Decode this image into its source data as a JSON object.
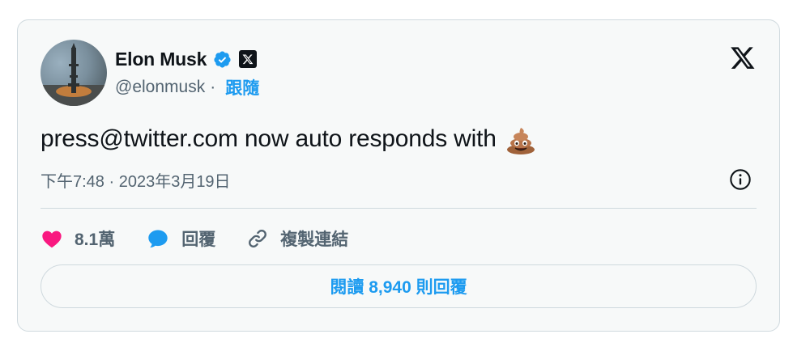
{
  "author": {
    "name": "Elon Musk",
    "handle": "@elonmusk",
    "separator": "·",
    "follow_label": "跟隨"
  },
  "tweet": {
    "text": "press@twitter.com now auto responds with",
    "emoji": "pile-of-poo",
    "timestamp": "下午7:48 · 2023年3月19日"
  },
  "actions": {
    "likes_label": "8.1萬",
    "reply_label": "回覆",
    "copy_link_label": "複製連結"
  },
  "read_replies_label": "閱讀 8,940 則回覆",
  "colors": {
    "accent": "#1d9bf0",
    "like": "#f91880",
    "text": "#0f1419",
    "secondary": "#536471",
    "card_bg": "#f7f9f9",
    "border": "#cfd9de"
  }
}
